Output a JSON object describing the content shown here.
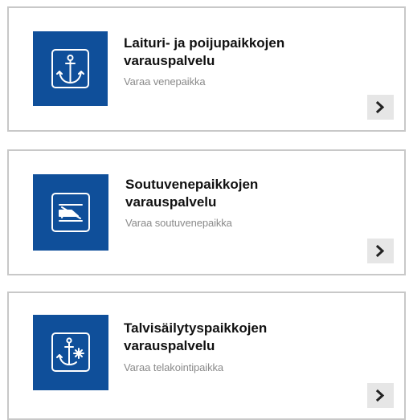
{
  "cards": [
    {
      "title_line1": "Laituri- ja poijupaikkojen",
      "title_line2": "varauspalvelu",
      "subtitle": "Varaa venepaikka",
      "icon": "anchor-icon"
    },
    {
      "title_line1": "Soutuvenepaikkojen",
      "title_line2": "varauspalvelu",
      "subtitle": "Varaa soutuvenepaikka",
      "icon": "rowboat-icon"
    },
    {
      "title_line1": "Talvisäilytyspaikkojen",
      "title_line2": "varauspalvelu",
      "subtitle": "Varaa telakointipaikka",
      "icon": "winter-anchor-icon"
    }
  ],
  "colors": {
    "icon_background": "#0f4f9a",
    "card_border": "#c8c8c8",
    "arrow_background": "#e6e6e6"
  }
}
